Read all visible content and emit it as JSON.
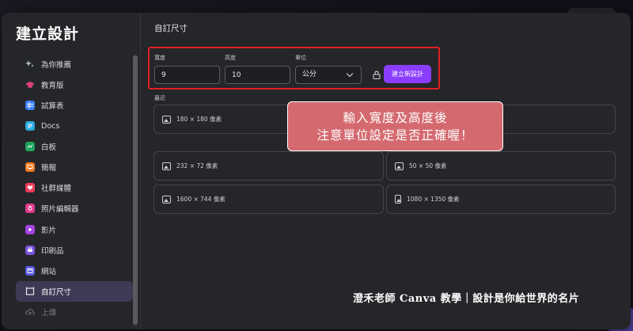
{
  "sidebar": {
    "title": "建立設計",
    "items": [
      {
        "label": "為你推薦",
        "icon": "sparkle-icon",
        "color": "#9aa0b4"
      },
      {
        "label": "教育版",
        "icon": "graduation-cap-icon",
        "color": "#e0407a"
      },
      {
        "label": "試算表",
        "icon": "table-icon",
        "color": "#3d7eff"
      },
      {
        "label": "Docs",
        "icon": "document-icon",
        "color": "#29a9e0"
      },
      {
        "label": "白板",
        "icon": "whiteboard-icon",
        "color": "#1fa35c"
      },
      {
        "label": "簡報",
        "icon": "presentation-icon",
        "color": "#f07b22"
      },
      {
        "label": "社群媒體",
        "icon": "heart-icon",
        "color": "#ef3b5a"
      },
      {
        "label": "照片編輯器",
        "icon": "photo-editor-icon",
        "color": "#e23a8d"
      },
      {
        "label": "影片",
        "icon": "video-icon",
        "color": "#a543e3"
      },
      {
        "label": "印刷品",
        "icon": "print-icon",
        "color": "#7b52e0"
      },
      {
        "label": "網站",
        "icon": "website-icon",
        "color": "#5a59e8"
      },
      {
        "label": "自訂尺寸",
        "icon": "custom-size-icon",
        "color": "#d8d8dc"
      },
      {
        "label": "上傳",
        "icon": "upload-icon",
        "color": "#d8d8dc"
      }
    ]
  },
  "main": {
    "title": "自訂尺寸",
    "width_label": "寬度",
    "width_value": "9",
    "height_label": "高度",
    "height_value": "10",
    "unit_label": "單位",
    "unit_value": "公分",
    "create_button": "建立新設計",
    "recent_label": "最近",
    "recent": [
      {
        "label": "180 × 180 像素"
      },
      {
        "label": "232 × 72 像素"
      },
      {
        "label": "50 × 50 像素"
      },
      {
        "label": "1600 × 744 像素"
      },
      {
        "label": "1080 × 1350 像素"
      }
    ]
  },
  "callout": {
    "line1": "輸入寬度及高度後",
    "line2": "注意單位設定是否正確喔！"
  },
  "watermark": "澄禾老師 Canva 教學｜設計是你給世界的名片",
  "colors": {
    "accent": "#8b3dff",
    "highlight": "#e02020",
    "callout_bg": "#d46a6f",
    "modal_bg": "#252629"
  }
}
